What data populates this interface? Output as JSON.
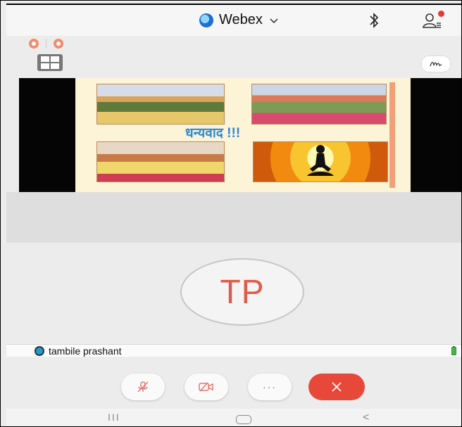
{
  "header": {
    "app_title": "Webex",
    "icons": [
      "webex-logo-icon",
      "chevron-down-icon",
      "bluetooth-icon",
      "participants-icon"
    ],
    "notification_color": "#e53935"
  },
  "toolbar": {
    "icons": [
      "mute-status-icon",
      "recording-status-icon",
      "layout-grid-icon",
      "annotate-icon"
    ],
    "status_color": "#f28c6c"
  },
  "shared_content": {
    "slide_text": "धन्यवाद !!!",
    "icons": [
      "yoga-silhouette-icon"
    ]
  },
  "participant": {
    "initials": "TP",
    "name": "tambile prashant",
    "initials_color": "#e25a4a",
    "icons": [
      "participant-status-icon",
      "battery-icon"
    ]
  },
  "call_controls": {
    "icons": [
      "mute-icon",
      "video-off-icon",
      "more-icon",
      "end-call-icon"
    ],
    "more_label": "···",
    "end_call_color": "#e8483a"
  },
  "system_nav": {
    "recent_label": "III",
    "back_label": "<",
    "icons": [
      "recent-apps-icon",
      "home-icon",
      "back-icon"
    ]
  }
}
